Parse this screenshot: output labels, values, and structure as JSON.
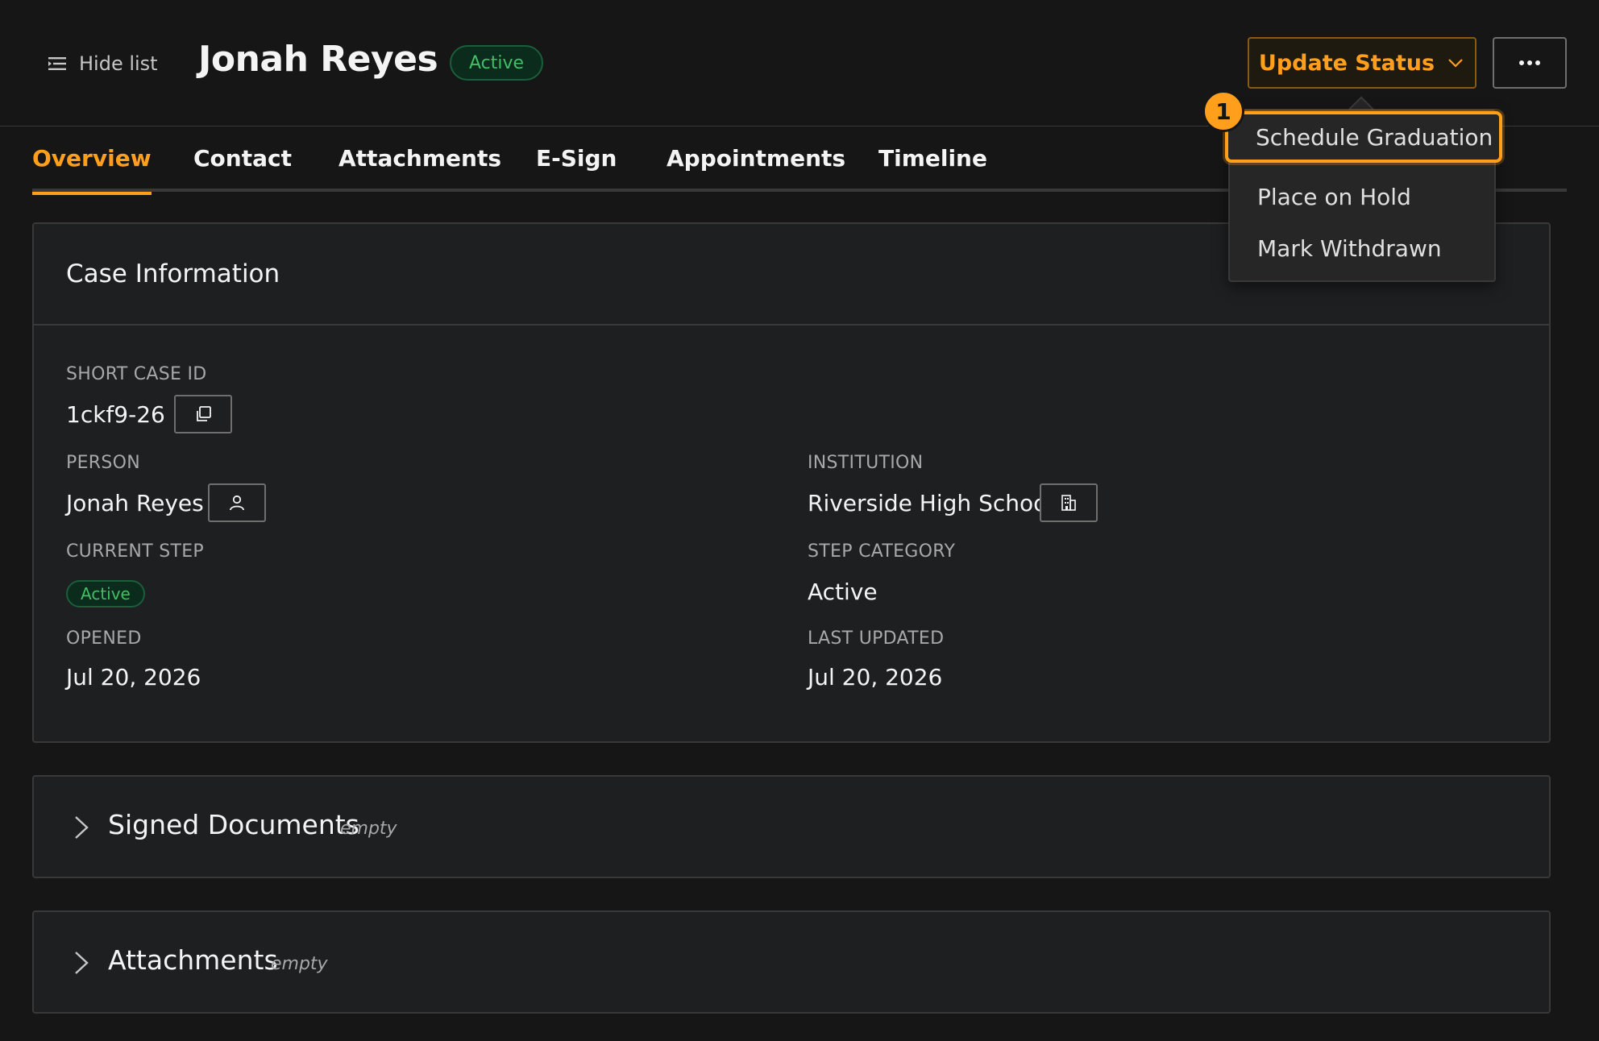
{
  "header": {
    "hide_list_label": "Hide list",
    "title": "Jonah Reyes",
    "status_badge": "Active",
    "update_status_label": "Update Status"
  },
  "tabs": [
    {
      "label": "Overview",
      "active": true
    },
    {
      "label": "Contact",
      "active": false
    },
    {
      "label": "Attachments",
      "active": false
    },
    {
      "label": "E-Sign",
      "active": false
    },
    {
      "label": "Appointments",
      "active": false
    },
    {
      "label": "Timeline",
      "active": false
    }
  ],
  "case_info": {
    "title": "Case Information",
    "short_case_id": {
      "label": "SHORT CASE ID",
      "value": "1ckf9-26"
    },
    "person": {
      "label": "PERSON",
      "value": "Jonah Reyes"
    },
    "institution": {
      "label": "INSTITUTION",
      "value": "Riverside High School"
    },
    "current_step": {
      "label": "CURRENT STEP",
      "value": "Active"
    },
    "step_category": {
      "label": "STEP CATEGORY",
      "value": "Active"
    },
    "opened": {
      "label": "OPENED",
      "value": "Jul 20, 2026"
    },
    "last_updated": {
      "label": "LAST UPDATED",
      "value": "Jul 20, 2026"
    }
  },
  "sections": {
    "signed_documents": {
      "title": "Signed Documents",
      "state": "empty"
    },
    "attachments": {
      "title": "Attachments",
      "state": "empty"
    }
  },
  "status_menu": {
    "items": [
      "Schedule Graduation",
      "Place on Hold",
      "Mark Withdrawn"
    ],
    "highlighted_index": 0
  },
  "annotation": {
    "step_number": "1"
  },
  "colors": {
    "accent": "#ff9f1c",
    "success": "#42be65",
    "background": "#161616",
    "card": "#1e1f21"
  },
  "icons": [
    "hamburger-list-icon",
    "chevron-down-icon",
    "overflow-menu-icon",
    "copy-icon",
    "user-icon",
    "building-icon",
    "chevron-right-icon"
  ]
}
